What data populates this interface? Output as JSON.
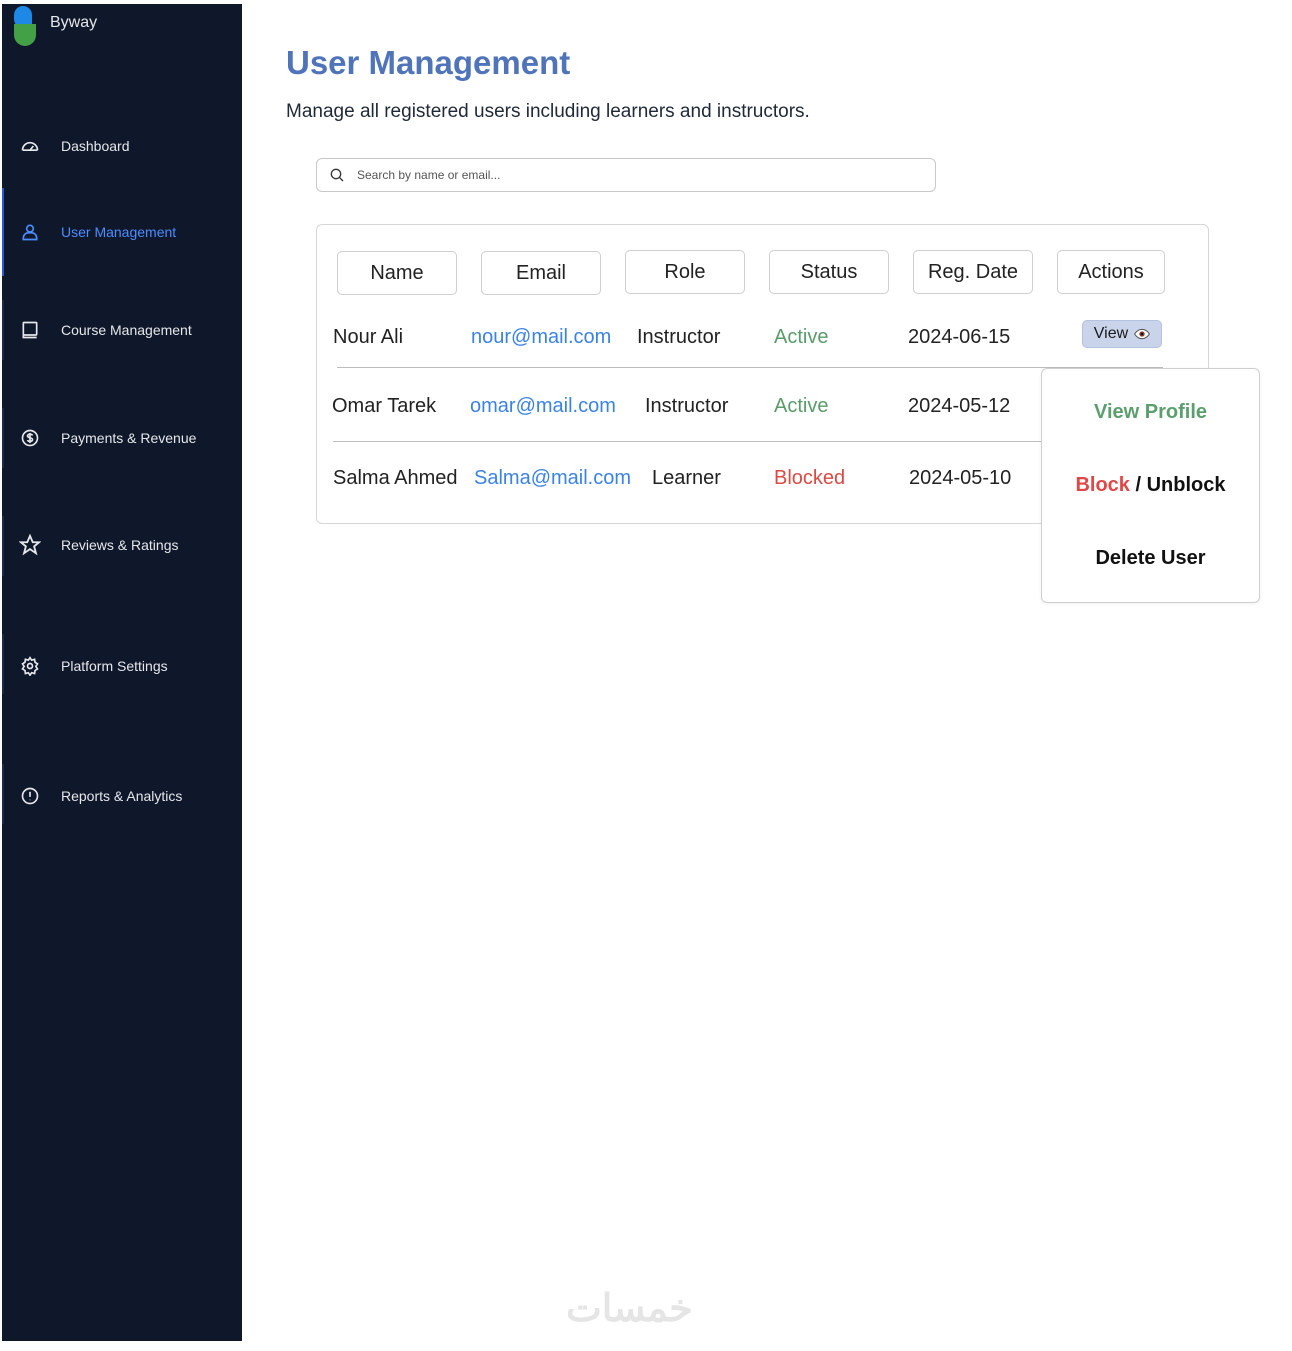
{
  "brand": {
    "name": "Byway"
  },
  "sidebar": {
    "items": [
      {
        "label": "Dashboard",
        "icon": "dashboard-gauge-icon"
      },
      {
        "label": "User Management",
        "icon": "user-icon",
        "active": true
      },
      {
        "label": "Course Management",
        "icon": "book-icon"
      },
      {
        "label": "Payments & Revenue",
        "icon": "dollar-circle-icon"
      },
      {
        "label": "Reviews & Ratings",
        "icon": "star-icon"
      },
      {
        "label": "Platform Settings",
        "icon": "gear-icon"
      },
      {
        "label": "Reports & Analytics",
        "icon": "alert-circle-icon"
      }
    ]
  },
  "header": {
    "title": "User Management",
    "subtitle": "Manage all registered users including learners and instructors."
  },
  "search": {
    "placeholder": "Search by name or email..."
  },
  "table": {
    "columns": [
      "Name",
      "Email",
      "Role",
      "Status",
      "Reg. Date",
      "Actions"
    ],
    "rows": [
      {
        "name": "Nour Ali",
        "email": "nour@mail.com",
        "role": "Instructor",
        "status": "Active",
        "date": "2024-06-15"
      },
      {
        "name": "Omar Tarek",
        "email": "omar@mail.com",
        "role": "Instructor",
        "status": "Active",
        "date": "2024-05-12"
      },
      {
        "name": "Salma Ahmed",
        "email": "Salma@mail.com",
        "role": "Learner",
        "status": "Blocked",
        "date": "2024-05-10"
      }
    ],
    "view_button": "View"
  },
  "actions_menu": {
    "view_profile": "View Profile",
    "block": "Block",
    "block_separator": " / ",
    "unblock": "Unblock",
    "delete": "Delete User"
  },
  "colors": {
    "sidebar_bg": "#0f172a",
    "accent": "#4c8dff",
    "title": "#4f74b9",
    "active_status": "#5a9b6a",
    "blocked_status": "#d94a44",
    "email_link": "#3b82e6"
  },
  "watermark": "خمسات"
}
